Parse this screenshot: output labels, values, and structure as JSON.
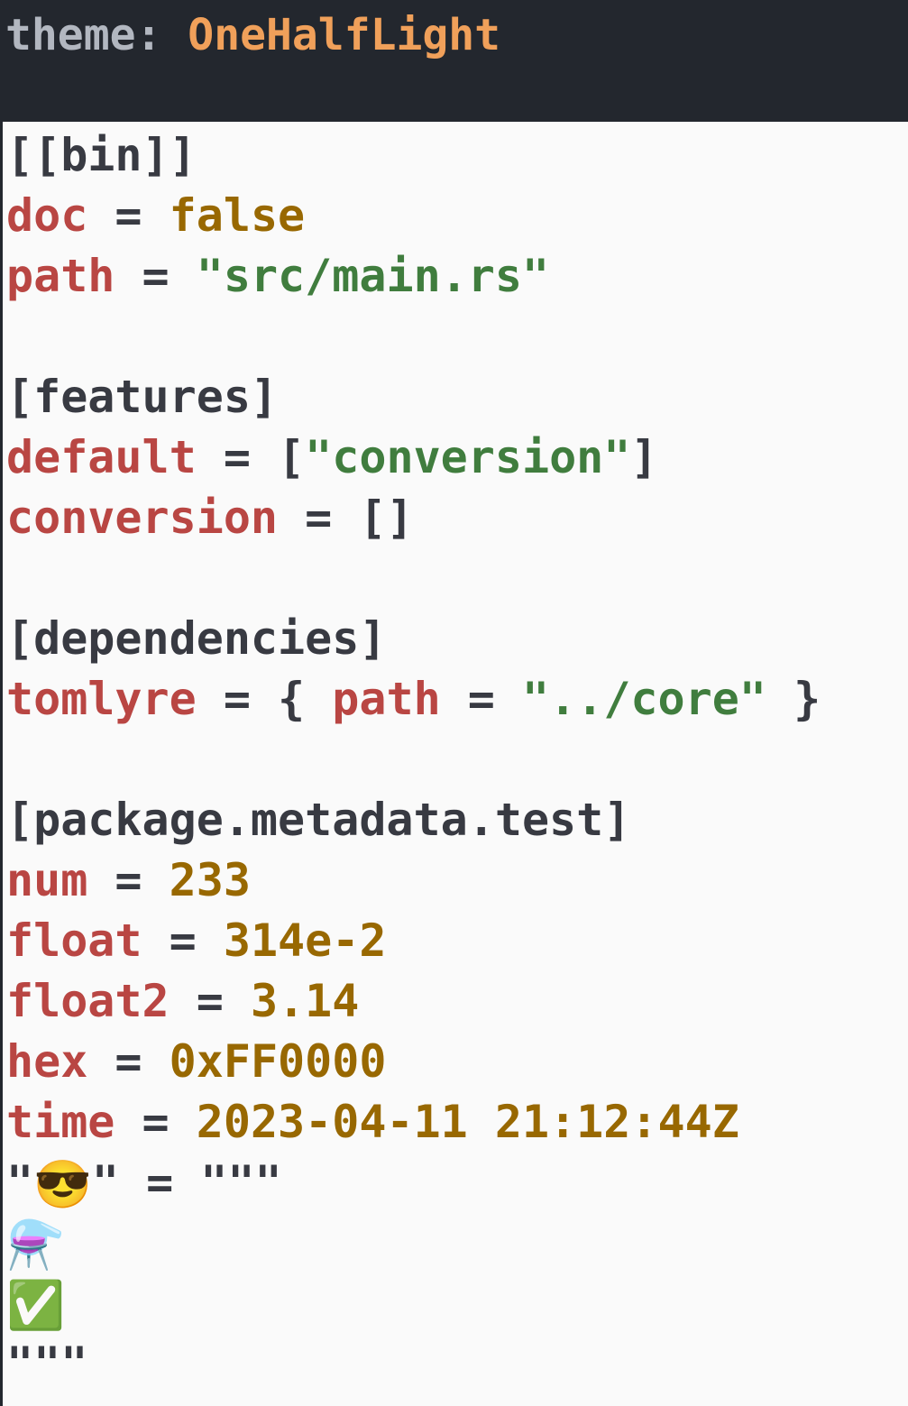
{
  "header": {
    "label": "theme:",
    "theme_name": "OneHalfLight"
  },
  "editor": {
    "lines": {
      "l1": {
        "header": "[[bin]]"
      },
      "l2": {
        "key": "doc",
        "eq": "=",
        "value": "false"
      },
      "l3": {
        "key": "path",
        "eq": "=",
        "value": "\"src/main.rs\""
      },
      "l5": {
        "header": "[features]"
      },
      "l6": {
        "key": "default",
        "eq": "=",
        "open": "[",
        "value": "\"conversion\"",
        "close": "]"
      },
      "l7": {
        "key": "conversion",
        "eq": "=",
        "value": "[]"
      },
      "l9": {
        "header": "[dependencies]"
      },
      "l10": {
        "key": "tomlyre",
        "eq": "=",
        "open": "{",
        "inner_key": "path",
        "inner_eq": "=",
        "value": "\"../core\"",
        "close": "}"
      },
      "l12": {
        "header": "[package.metadata.test]"
      },
      "l13": {
        "key": "num",
        "eq": "=",
        "value": "233"
      },
      "l14": {
        "key": "float",
        "eq": "=",
        "value": "314e-2"
      },
      "l15": {
        "key": "float2",
        "eq": "=",
        "value": "3.14"
      },
      "l16": {
        "key": "hex",
        "eq": "=",
        "value": "0xFF0000"
      },
      "l17": {
        "key": "time",
        "eq": "=",
        "value": "2023-04-11 21:12:44Z"
      },
      "l18": {
        "quote_open": "\"",
        "emoji": "😎",
        "quote_close": "\"",
        "eq": "=",
        "value": "\"\"\""
      },
      "l19": {
        "emoji": "⚗️"
      },
      "l20": {
        "emoji": "✅"
      },
      "l21": {
        "value": "\"\"\""
      }
    }
  },
  "colors": {
    "header_bg": "#23272e",
    "editor_bg": "#fafafa",
    "key": "#b94643",
    "string": "#407d3e",
    "number": "#986801",
    "punctuation": "#383a42",
    "theme_name": "#f0a05a",
    "theme_label": "#b2b7c0"
  }
}
